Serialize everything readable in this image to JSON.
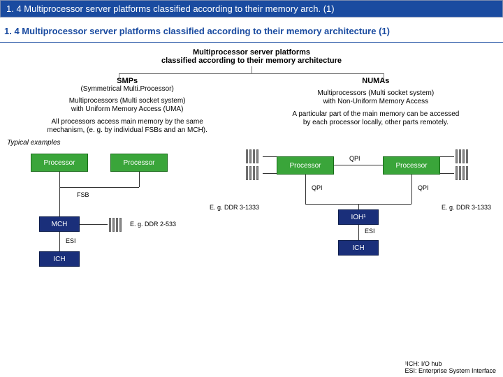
{
  "titlebar": "1. 4 Multiprocessor server platforms classified according to their memory arch. (1)",
  "subtitle": "1. 4 Multiprocessor server platforms classified according to their memory architecture (1)",
  "tree_root_line1": "Multiprocessor server platforms",
  "tree_root_line2": "classified according to their memory architecture",
  "smp": {
    "title": "SMPs",
    "sub": "(Symmetrical Multi.Processor)",
    "desc1": "Multiprocessors (Multi socket system)\nwith Uniform Memory Access (UMA)",
    "desc2": "All processors access main memory by the same\nmechanism, (e. g. by individual FSBs and an MCH)."
  },
  "numa": {
    "title": "NUMAs",
    "sub": "",
    "desc1": "Multiprocessors (Multi socket system)\nwith Non-Uniform Memory Access",
    "desc2": "A particular part of the main memory can be accessed\nby each processor locally, other parts remotely."
  },
  "examples_label": "Typical examples",
  "labels": {
    "processor": "Processor",
    "fsb": "FSB",
    "mch": "MCH",
    "ich": "ICH",
    "esi": "ESI",
    "ioh": "IOH¹",
    "qpi": "QPI",
    "ddr3": "E. g. DDR 3-1333",
    "ddr2": "E. g. DDR 2-533"
  },
  "footnotes": {
    "l1": "¹ICH: I/O hub",
    "l2": "ESI: Enterprise System Interface"
  }
}
